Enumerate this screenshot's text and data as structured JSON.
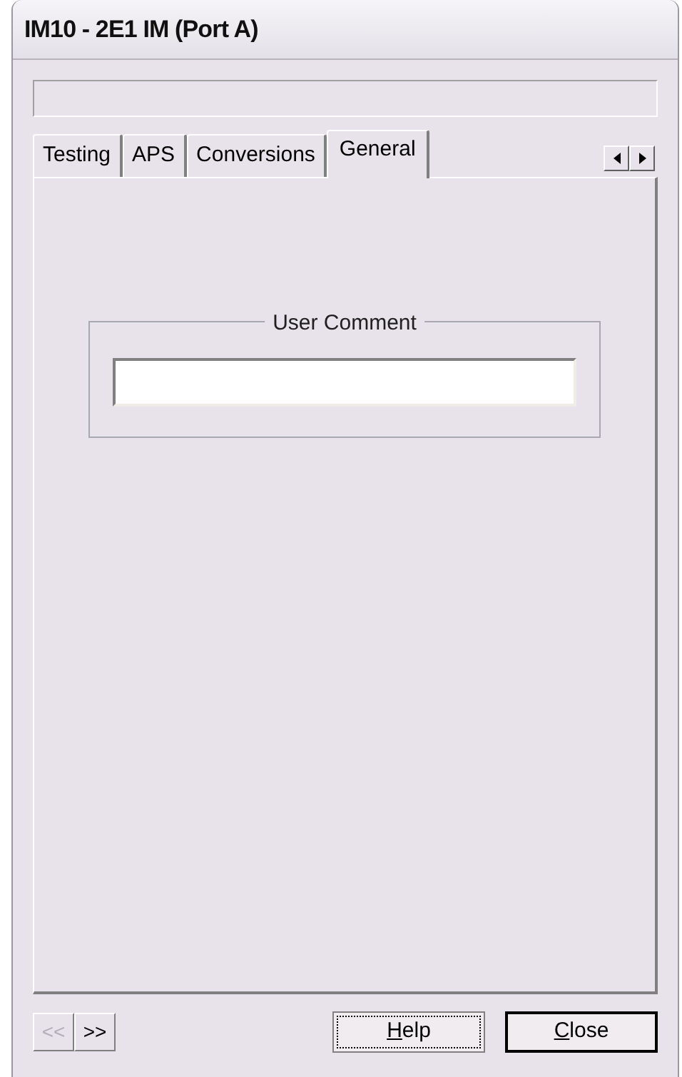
{
  "window": {
    "title": "IM10 - 2E1 IM (Port A)"
  },
  "tabs": [
    {
      "label": "Testing",
      "selected": false
    },
    {
      "label": "APS",
      "selected": false
    },
    {
      "label": "Conversions",
      "selected": false
    },
    {
      "label": "General",
      "selected": true
    }
  ],
  "group": {
    "title": "User Comment"
  },
  "nav_buttons": [
    {
      "label": "<<",
      "disabled": true
    },
    {
      "label": ">>",
      "disabled": false
    }
  ],
  "buttons": [
    {
      "label": "Help",
      "focused": true,
      "underline_first": true
    },
    {
      "label": "Close",
      "focused": false,
      "underline_first": true
    }
  ]
}
